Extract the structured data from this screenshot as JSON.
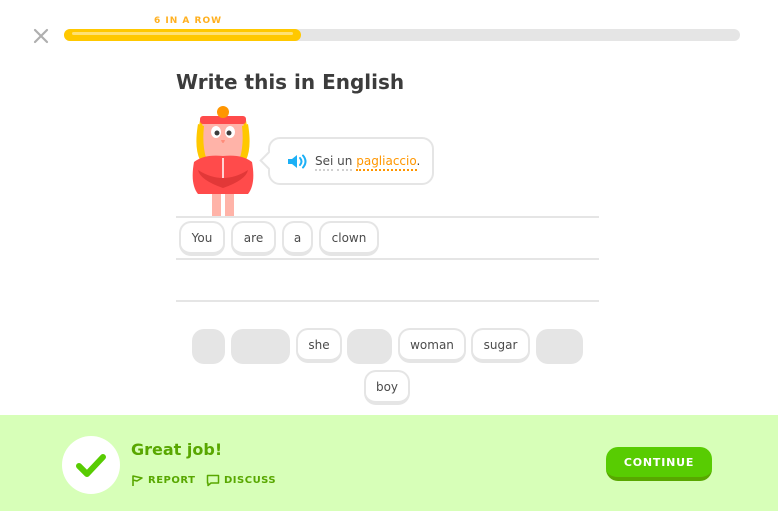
{
  "header": {
    "streak_label": "6 IN A ROW",
    "progress_fraction": 0.35,
    "progress_color": "#ffc800",
    "close_icon": "close-icon"
  },
  "prompt": {
    "title": "Write this in English",
    "character_icon": "character-illustration",
    "speaker_icon": "speaker-icon",
    "sentence_words": [
      "Sei",
      "un",
      "pagliaccio"
    ],
    "sentence_punct": ".",
    "highlight_color": "#ff9600"
  },
  "answer_tiles": [
    "You",
    "are",
    "a",
    "clown"
  ],
  "word_bank": {
    "row1": [
      "she",
      "woman",
      "sugar"
    ],
    "row2": [
      "boy"
    ]
  },
  "footer": {
    "feedback": "Great job!",
    "report": "REPORT",
    "discuss": "DISCUSS",
    "continue": "CONTINUE",
    "accent_color": "#58cc02",
    "background_color": "#d7ffb8"
  }
}
